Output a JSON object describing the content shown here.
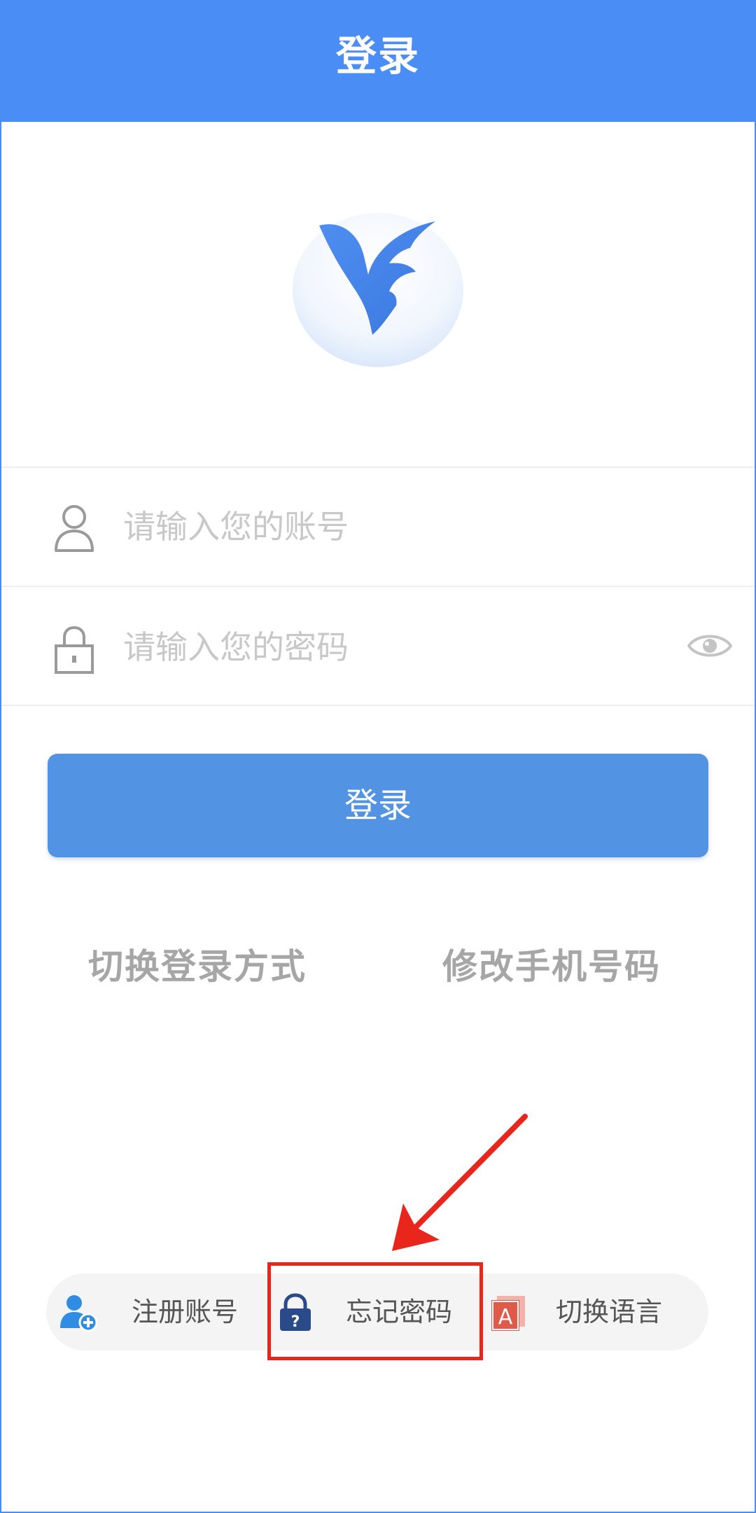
{
  "header": {
    "title": "登录"
  },
  "logo": {
    "icon": "feishu-bird-logo-icon"
  },
  "account_field": {
    "icon": "user-icon",
    "value": "",
    "placeholder": "请输入您的账号"
  },
  "password_field": {
    "icon": "lock-icon",
    "value": "",
    "placeholder": "请输入您的密码",
    "toggle_icon": "eye-icon"
  },
  "login_button": {
    "label": "登录"
  },
  "links": {
    "switch_login_method": "切换登录方式",
    "change_phone": "修改手机号码"
  },
  "bottom_actions": [
    {
      "label": "注册账号",
      "icon": "add-user-icon"
    },
    {
      "label": "忘记密码",
      "icon": "lock-question-icon"
    },
    {
      "label": "切换语言",
      "icon": "language-a-icon"
    }
  ],
  "colors": {
    "header": "#4a8df5",
    "login_button": "#5293e3",
    "annotation": "#e8261b"
  }
}
